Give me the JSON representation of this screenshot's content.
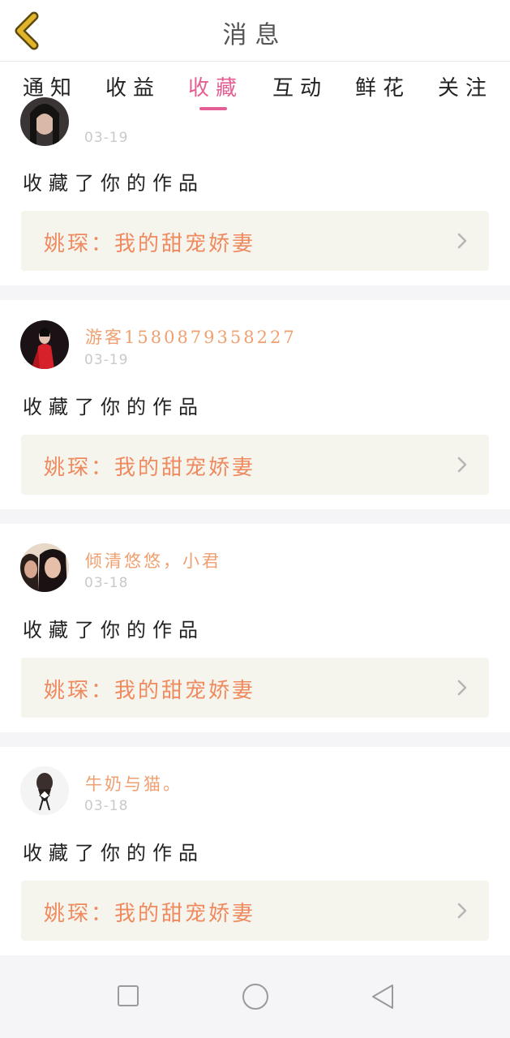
{
  "header": {
    "title": "消息"
  },
  "tabs": [
    {
      "label": "通知",
      "active": false
    },
    {
      "label": "收益",
      "active": false
    },
    {
      "label": "收藏",
      "active": true
    },
    {
      "label": "互动",
      "active": false
    },
    {
      "label": "鲜花",
      "active": false
    },
    {
      "label": "关注",
      "active": false
    }
  ],
  "items": [
    {
      "username": "",
      "date": "03-19",
      "action": "收藏了你的作品",
      "work_title": "姚琛：我的甜宠娇妻"
    },
    {
      "username": "游客1580879358227",
      "date": "03-19",
      "action": "收藏了你的作品",
      "work_title": "姚琛：我的甜宠娇妻"
    },
    {
      "username": "倾清悠悠，小君",
      "date": "03-18",
      "action": "收藏了你的作品",
      "work_title": "姚琛：我的甜宠娇妻"
    },
    {
      "username": "牛奶与猫。",
      "date": "03-18",
      "action": "收藏了你的作品",
      "work_title": "姚琛：我的甜宠娇妻"
    }
  ],
  "colors": {
    "accent": "#e35f93",
    "username": "#f0a070",
    "work_title": "#ef8a5f",
    "work_box": "#f5f5ee",
    "back_arrow": "#e2b429"
  },
  "icons": {
    "back": "chevron-left-icon",
    "item_arrow": "chevron-right-icon",
    "nav_recents": "square-icon",
    "nav_home": "circle-icon",
    "nav_back": "triangle-left-icon"
  }
}
